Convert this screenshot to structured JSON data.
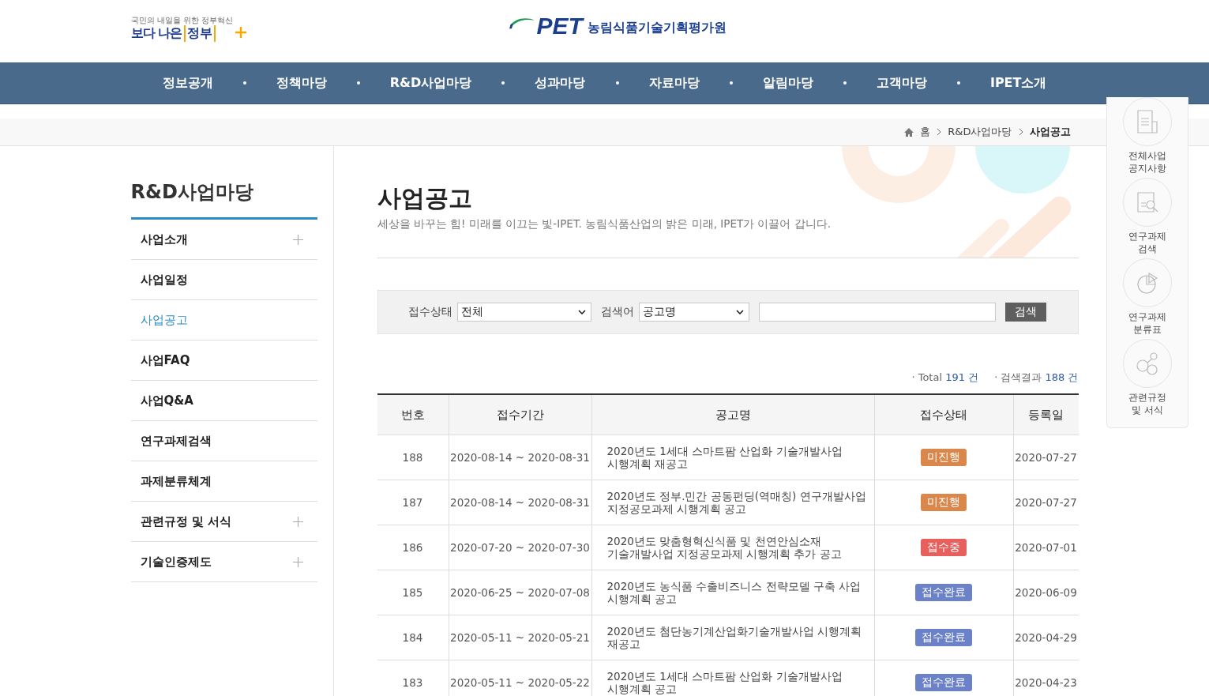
{
  "header": {
    "gov_logo": {
      "tagline": "국민의 내일을 위한 정부혁신",
      "text_a": "보다 나은",
      "text_b": "정부"
    },
    "org_logo": {
      "mark": "PET",
      "name": "농림식품기술기획평가원"
    }
  },
  "nav": [
    "정보공개",
    "정책마당",
    "R&D사업마당",
    "성과마당",
    "자료마당",
    "알림마당",
    "고객마당",
    "IPET소개"
  ],
  "breadcrumb": [
    "홈",
    "R&D사업마당",
    "사업공고"
  ],
  "quick_menu": [
    {
      "kind": "news",
      "label": "전체사업 공지사항"
    },
    {
      "kind": "search",
      "label": "연구과제 검색"
    },
    {
      "kind": "chart",
      "label": "연구과제 분류표"
    },
    {
      "kind": "link",
      "label": "관련규정 및 서식"
    }
  ],
  "sidebar": {
    "title": "R&D사업마당",
    "items": [
      {
        "label": "사업소개",
        "expandable": true,
        "selected": false
      },
      {
        "label": "사업일정",
        "expandable": false,
        "selected": false
      },
      {
        "label": "사업공고",
        "expandable": false,
        "selected": true
      },
      {
        "label": "사업FAQ",
        "expandable": false,
        "selected": false
      },
      {
        "label": "사업Q&A",
        "expandable": false,
        "selected": false
      },
      {
        "label": "연구과제검색",
        "expandable": false,
        "selected": false
      },
      {
        "label": "과제분류체계",
        "expandable": false,
        "selected": false
      },
      {
        "label": "관련규정 및 서식",
        "expandable": true,
        "selected": false
      },
      {
        "label": "기술인증제도",
        "expandable": true,
        "selected": false
      }
    ]
  },
  "page": {
    "title": "사업공고",
    "subtitle": "세상을 바꾸는 힘! 미래를 이끄는 빛-IPET. 농림식품산업의 밝은 미래, IPET가 이끌어 갑니다."
  },
  "search": {
    "status_label": "접수상태",
    "status_value": "전체",
    "keyword_label": "검색어",
    "keyword_field": "공고명",
    "button": "검색"
  },
  "totals": [
    {
      "label": "· Total",
      "count": "191 건"
    },
    {
      "label": "· 검색결과",
      "count": "188 건"
    }
  ],
  "table": {
    "columns": [
      "번호",
      "접수기간",
      "공고명",
      "접수상태",
      "등록일"
    ],
    "rows": [
      {
        "no": "188",
        "period": "2020-08-14 ~ 2020-08-31",
        "title": "2020년도 1세대 스마트팜 산업화 기술개발사업 시행계획 재공고",
        "status": "미진행",
        "color": "#d9874a",
        "date": "2020-07-27"
      },
      {
        "no": "187",
        "period": "2020-08-14 ~ 2020-08-31",
        "title": "2020년도 정부.민간 공동펀딩(역매칭) 연구개발사업 지정공모과제 시행계획 공고",
        "status": "미진행",
        "color": "#d9874a",
        "date": "2020-07-27"
      },
      {
        "no": "186",
        "period": "2020-07-20 ~ 2020-07-30",
        "title": "2020년도 맞춤형혁신식품 및 천연안심소재 기술개발사업 지정공모과제 시행계획 추가 공고",
        "status": "접수중",
        "color": "#e8605e",
        "date": "2020-07-01"
      },
      {
        "no": "185",
        "period": "2020-06-25 ~ 2020-07-08",
        "title": "2020년도 농식품 수출비즈니스 전략모델 구축 사업 시행계획 공고",
        "status": "접수완료",
        "color": "#6b82c8",
        "date": "2020-06-09"
      },
      {
        "no": "184",
        "period": "2020-05-11 ~ 2020-05-21",
        "title": "2020년도 첨단농기계산업화기술개발사업 시행계획 재공고",
        "status": "접수완료",
        "color": "#6b82c8",
        "date": "2020-04-29"
      },
      {
        "no": "183",
        "period": "2020-05-11 ~ 2020-05-22",
        "title": "2020년도 1세대 스마트팜 산업화 기술개발사업 시행계획 공고",
        "status": "접수완료",
        "color": "#6b82c8",
        "date": "2020-04-23"
      }
    ]
  }
}
